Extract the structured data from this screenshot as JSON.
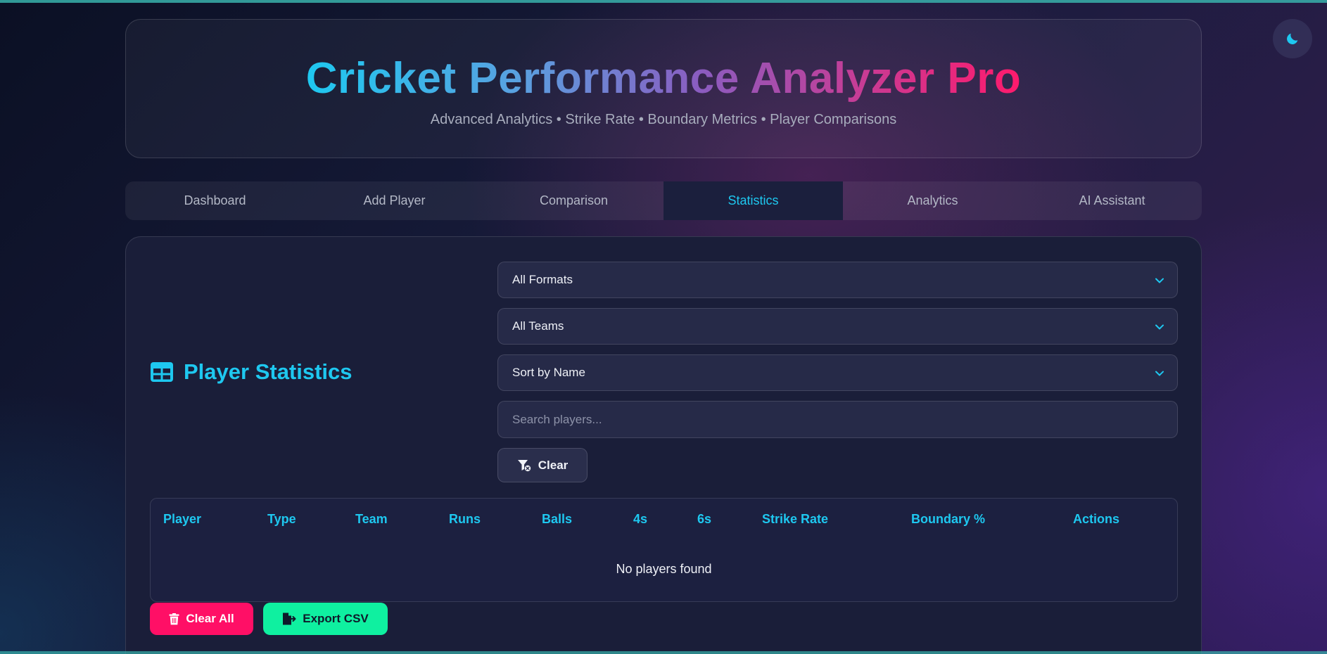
{
  "header": {
    "title": "Cricket Performance Analyzer Pro",
    "subtitle": "Advanced Analytics • Strike Rate • Boundary Metrics • Player Comparisons"
  },
  "nav": {
    "tabs": [
      {
        "label": "Dashboard",
        "active": false
      },
      {
        "label": "Add Player",
        "active": false
      },
      {
        "label": "Comparison",
        "active": false
      },
      {
        "label": "Statistics",
        "active": true
      },
      {
        "label": "Analytics",
        "active": false
      },
      {
        "label": "AI Assistant",
        "active": false
      }
    ]
  },
  "statistics": {
    "title": "Player Statistics",
    "filters": {
      "format": "All Formats",
      "team": "All Teams",
      "sort": "Sort by Name",
      "search_placeholder": "Search players...",
      "search_value": "",
      "clear_label": "Clear"
    },
    "table": {
      "columns": [
        "Player",
        "Type",
        "Team",
        "Runs",
        "Balls",
        "4s",
        "6s",
        "Strike Rate",
        "Boundary %",
        "Actions"
      ],
      "rows": [],
      "empty_message": "No players found"
    },
    "actions": {
      "clear_all_label": "Clear All",
      "export_label": "Export CSV"
    }
  },
  "colors": {
    "accent": "#1ec8f0",
    "danger": "#ff0f66",
    "success": "#0ff0a0"
  },
  "icons": {
    "theme_toggle": "moon-icon",
    "section": "table-icon",
    "select": "chevron-down-icon",
    "clear": "filter-clear-icon",
    "clear_all": "trash-icon",
    "export": "file-export-icon"
  }
}
